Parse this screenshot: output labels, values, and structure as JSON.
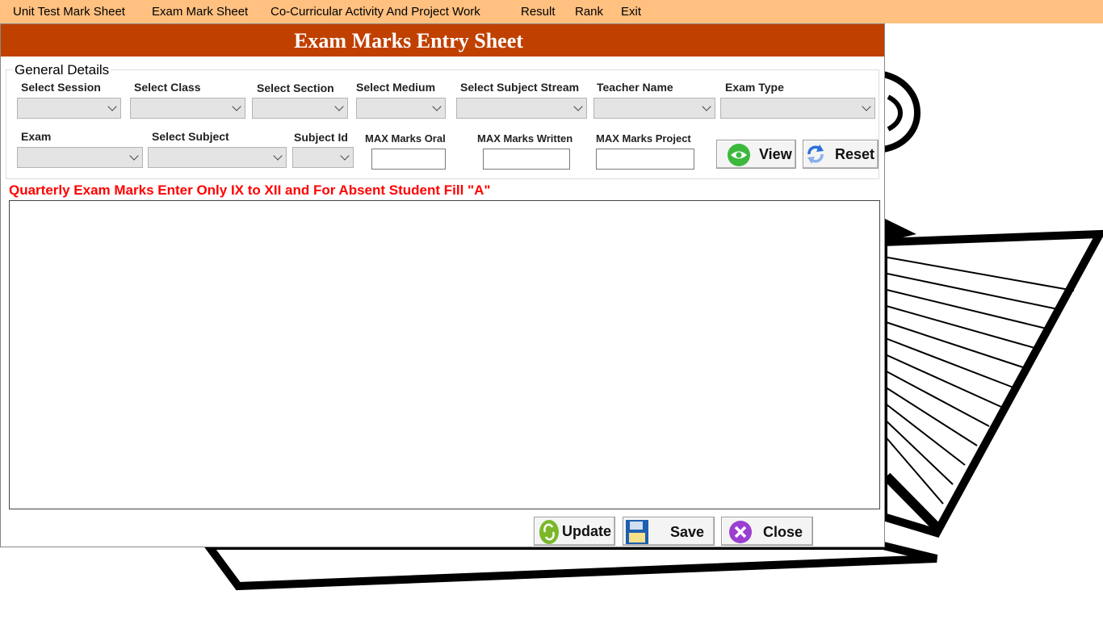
{
  "menu": {
    "items": [
      "Unit Test Mark Sheet",
      "Exam Mark Sheet",
      "Co-Curricular Activity And Project Work",
      "Result",
      "Rank",
      "Exit"
    ]
  },
  "form": {
    "title": "Exam Marks Entry Sheet",
    "group_title": "General Details",
    "labels": {
      "session": "Select Session",
      "class": "Select Class",
      "section": "Select Section",
      "medium": "Select Medium",
      "stream": "Select Subject Stream",
      "teacher": "Teacher Name",
      "exam_type": "Exam Type",
      "exam": "Exam",
      "subject": "Select Subject",
      "subject_id": "Subject Id",
      "max_oral": "MAX Marks Oral",
      "max_written": "MAX Marks Written",
      "max_project": "MAX Marks Project"
    },
    "buttons": {
      "view": "View",
      "reset": "Reset",
      "update": "Update",
      "save": "Save",
      "close": "Close"
    },
    "note": "Quarterly Exam Marks Enter Only IX to XII  and For Absent Student Fill \"A\""
  },
  "colors": {
    "menubar": "#ffc080",
    "titlebar": "#c04000",
    "note": "#ff0000"
  }
}
